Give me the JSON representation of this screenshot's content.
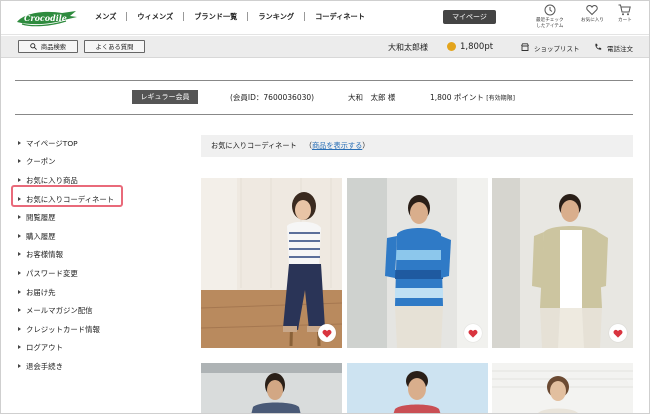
{
  "header": {
    "logo_text": "Crocodile",
    "nav": [
      "メンズ",
      "ウィメンズ",
      "ブランド一覧",
      "ランキング",
      "コーディネート"
    ],
    "mypage_label": "マイページ",
    "icons": [
      {
        "name": "recent-items-icon",
        "label_line1": "最近チェック",
        "label_line2": "したアイテム"
      },
      {
        "name": "favorites-heart-icon",
        "label_line1": "お気に入り",
        "label_line2": ""
      },
      {
        "name": "cart-icon",
        "label_line1": "カート",
        "label_line2": ""
      }
    ]
  },
  "subbar": {
    "search_label": "商品検索",
    "faq_label": "よくある質問",
    "user_name": "大和太郎様",
    "points": "1,800pt",
    "shoplist_label": "ショップリスト",
    "phone_label": "電話注文"
  },
  "member": {
    "badge": "レギュラー会員",
    "id_text": "(会員ID：7600036030)",
    "name_text": "大和　太郎 様",
    "points_text": "1,800 ポイント",
    "points_note": "[有効期限]"
  },
  "sidebar": {
    "items": [
      {
        "label": "マイページTOP"
      },
      {
        "label": "クーポン"
      },
      {
        "label": "お気に入り商品"
      },
      {
        "label": "お気に入りコーディネート",
        "active": true
      },
      {
        "label": "閲覧履歴"
      },
      {
        "label": "購入履歴"
      },
      {
        "label": "お客様情報"
      },
      {
        "label": "パスワード変更"
      },
      {
        "label": "お届け先"
      },
      {
        "label": "メールマガジン配信"
      },
      {
        "label": "クレジットカード情報"
      },
      {
        "label": "ログアウト"
      },
      {
        "label": "退会手続き"
      }
    ]
  },
  "content": {
    "title": "お気に入りコーディネート",
    "paren_open": "（",
    "show_items_link": "商品を表示する",
    "paren_close": "）"
  },
  "colors": {
    "accent_red": "#d9343f",
    "highlight": "#e96a7a",
    "link": "#2a6fb6",
    "dark_button": "#444444"
  }
}
